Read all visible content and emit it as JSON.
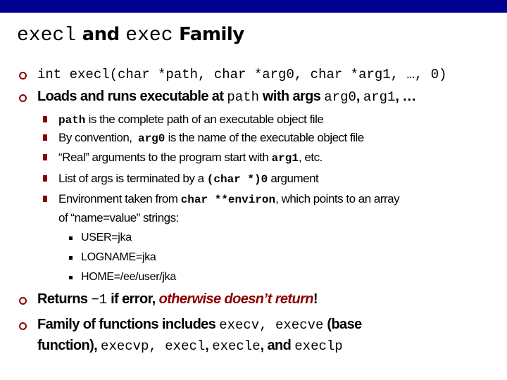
{
  "colors": {
    "topbar": "#000090",
    "accent": "#8b0000"
  },
  "title": {
    "part1": "execl",
    "part2": " and ",
    "part3": "exec",
    "part4": " Family"
  },
  "bullets": {
    "b1": {
      "code": "int execl(char *path, char *arg0, char *arg1, …, 0)"
    },
    "b2": {
      "t1": "Loads and runs executable at ",
      "c1": "path",
      "t2": " with args ",
      "c2": "arg0",
      "t3": ", ",
      "c3": "arg1",
      "t4": ", …"
    },
    "sub": {
      "s1": {
        "c1": "path",
        "t1": " is the complete path of an executable object file"
      },
      "s2": {
        "t1": "By convention,  ",
        "c1": "arg0",
        "t2": " is the name of the executable object file"
      },
      "s3": {
        "t1": "“Real” arguments to the program start with ",
        "c1": "arg1",
        "t2": ", etc."
      },
      "s4": {
        "t1": "List of args is terminated by a ",
        "c1": "(char *)0",
        "t2": " argument"
      },
      "s5": {
        "t1": "Environment taken from ",
        "c1": "char **environ",
        "t2": ", which points to an array",
        "t3": "of “name=value” strings:"
      }
    },
    "env": [
      "USER=jka",
      "LOGNAME=jka",
      "HOME=/ee/user/jka"
    ],
    "b3": {
      "t1": "Returns ",
      "c1": "−1",
      "t2": " if error, ",
      "emph": "otherwise doesn’t return",
      "t3": "!"
    },
    "b4": {
      "t1": "Family of functions includes ",
      "c1": "execv, execve",
      "t2": " (base",
      "t3": "function), ",
      "c2": "execvp, execl",
      "t4": ", ",
      "c3": "execle",
      "t5": ", and ",
      "c4": "execlp"
    }
  }
}
